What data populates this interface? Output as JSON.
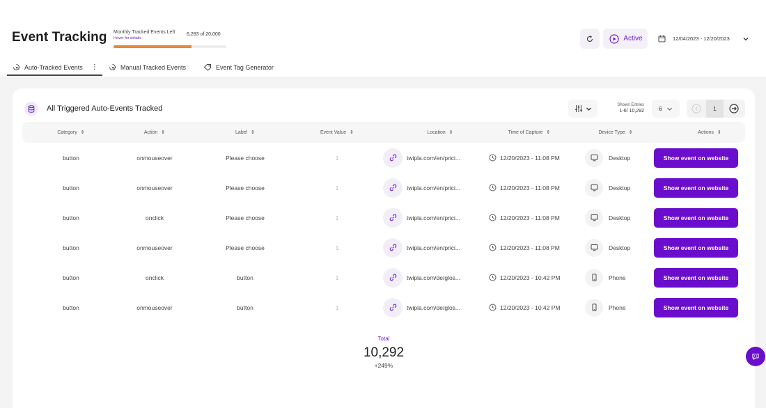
{
  "header": {
    "title": "Event Tracking",
    "quota": {
      "label": "Monthly Tracked Events Left",
      "hint": "Hover for details",
      "count": "6,283 of 20,000",
      "progress": 0.69,
      "bar_color": "#e8893a"
    },
    "refresh_icon": "refresh-icon",
    "active_label": "Active",
    "date_range": "12/04/2023 - 12/20/2023"
  },
  "tabs": [
    {
      "label": "Auto-Tracked Events",
      "active": true
    },
    {
      "label": "Manual Tracked Events",
      "active": false
    },
    {
      "label": "Event Tag Generator",
      "active": false
    }
  ],
  "card": {
    "title": "All Triggered Auto-Events Tracked",
    "shown_entries_label": "Shown Entries",
    "shown_entries_count": "1-6/ 10,292",
    "entries_per_page": "6",
    "current_page": "1"
  },
  "table": {
    "columns": [
      "Category",
      "Action",
      "Label",
      "Event Value",
      "Location",
      "Time of Capture",
      "Device Type",
      "Actions"
    ],
    "rows": [
      {
        "category": "button",
        "action": "onmouseover",
        "label": "Please choose",
        "value": "1",
        "location": "twipla.com/en/prici...",
        "time": "12/20/2023 - 11:08 PM",
        "device": "Desktop",
        "button": "Show event on website"
      },
      {
        "category": "button",
        "action": "onmouseover",
        "label": "Please choose",
        "value": "1",
        "location": "twipla.com/en/prici...",
        "time": "12/20/2023 - 11:08 PM",
        "device": "Desktop",
        "button": "Show event on website"
      },
      {
        "category": "button",
        "action": "onclick",
        "label": "Please choose",
        "value": "1",
        "location": "twipla.com/en/prici...",
        "time": "12/20/2023 - 11:08 PM",
        "device": "Desktop",
        "button": "Show event on website"
      },
      {
        "category": "button",
        "action": "onmouseover",
        "label": "Please choose",
        "value": "1",
        "location": "twipla.com/en/prici...",
        "time": "12/20/2023 - 11:08 PM",
        "device": "Desktop",
        "button": "Show event on website"
      },
      {
        "category": "button",
        "action": "onclick",
        "label": "button",
        "value": "1",
        "location": "twipla.com/de/glos...",
        "time": "12/20/2023 - 10:42 PM",
        "device": "Phone",
        "button": "Show event on website"
      },
      {
        "category": "button",
        "action": "onmouseover",
        "label": "button",
        "value": "1",
        "location": "twipla.com/de/glos...",
        "time": "12/20/2023 - 10:42 PM",
        "device": "Phone",
        "button": "Show event on website"
      }
    ]
  },
  "total": {
    "label": "Total",
    "value": "10,292",
    "delta": "+249%"
  },
  "colors": {
    "accent": "#6a0dcc",
    "progress": "#e8893a"
  }
}
